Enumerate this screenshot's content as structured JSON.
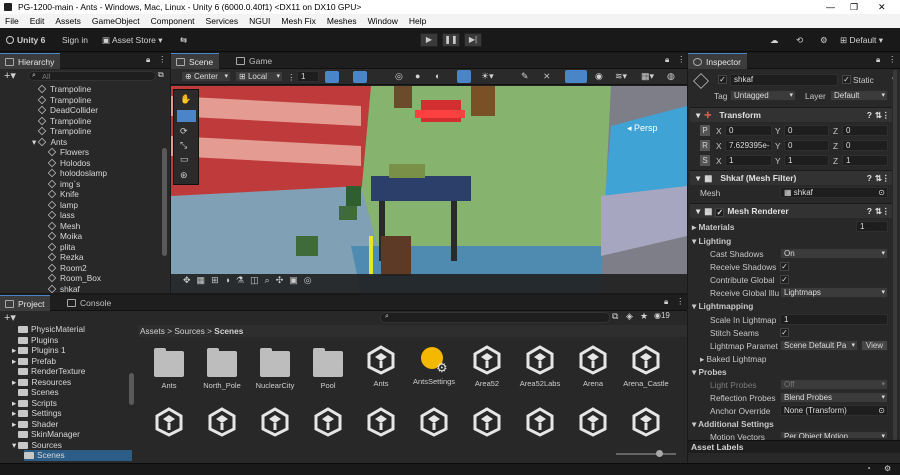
{
  "window": {
    "title": "PG-1200-main - Ants - Windows, Mac, Linux - Unity 6 (6000.0.40f1) <DX11 on DX10 GPU>"
  },
  "menu": [
    "File",
    "Edit",
    "Assets",
    "GameObject",
    "Component",
    "Services",
    "NGUI",
    "Mesh Fix",
    "Meshes",
    "Window",
    "Help"
  ],
  "toolbar": {
    "unity_label": "Unity 6",
    "signin": "Sign in",
    "asset_store": "Asset Store",
    "layout": "Default"
  },
  "hierarchy": {
    "tab": "Hierarchy",
    "search_placeholder": "All",
    "items": [
      {
        "label": "Trampoline",
        "indent": 1
      },
      {
        "label": "Trampoline",
        "indent": 1
      },
      {
        "label": "DeadCollider",
        "indent": 1
      },
      {
        "label": "Trampoline",
        "indent": 1
      },
      {
        "label": "Trampoline",
        "indent": 1
      },
      {
        "label": "Ants",
        "indent": 0,
        "expanded": true
      },
      {
        "label": "Flowers",
        "indent": 2
      },
      {
        "label": "Holodos",
        "indent": 2
      },
      {
        "label": "holodoslamp",
        "indent": 2
      },
      {
        "label": "img`s",
        "indent": 2
      },
      {
        "label": "Knife",
        "indent": 2
      },
      {
        "label": "lamp",
        "indent": 2
      },
      {
        "label": "lass",
        "indent": 2
      },
      {
        "label": "Mesh",
        "indent": 2
      },
      {
        "label": "Moika",
        "indent": 2
      },
      {
        "label": "plita",
        "indent": 2
      },
      {
        "label": "Rezka",
        "indent": 2
      },
      {
        "label": "Room2",
        "indent": 2
      },
      {
        "label": "Room_Box",
        "indent": 2
      },
      {
        "label": "shkaf",
        "indent": 2
      }
    ]
  },
  "scene": {
    "tabs": [
      "Scene",
      "Game"
    ],
    "pivot": "Center",
    "space": "Local",
    "snap": "1",
    "persp_label": "Persp"
  },
  "project": {
    "tabs": [
      "Project",
      "Console"
    ],
    "tree": [
      {
        "label": "PhysicMaterial",
        "indent": 1
      },
      {
        "label": "Plugins",
        "indent": 1
      },
      {
        "label": "Plugins 1",
        "indent": 0
      },
      {
        "label": "Prefab",
        "indent": 0
      },
      {
        "label": "RenderTexture",
        "indent": 1
      },
      {
        "label": "Resources",
        "indent": 0
      },
      {
        "label": "Scenes",
        "indent": 1
      },
      {
        "label": "Scripts",
        "indent": 0
      },
      {
        "label": "Settings",
        "indent": 0
      },
      {
        "label": "Shader",
        "indent": 0
      },
      {
        "label": "SkinManager",
        "indent": 1
      },
      {
        "label": "Sources",
        "indent": 0,
        "expanded": true
      },
      {
        "label": "Scenes",
        "indent": 2,
        "selected": true
      }
    ],
    "breadcrumb": [
      "Assets",
      "Sources",
      "Scenes"
    ],
    "count": "19",
    "assets_row1": [
      {
        "label": "Ants",
        "kind": "folder"
      },
      {
        "label": "North_Pole",
        "kind": "folder"
      },
      {
        "label": "NuclearCity",
        "kind": "folder"
      },
      {
        "label": "Pool",
        "kind": "folder"
      },
      {
        "label": "Ants",
        "kind": "unity"
      },
      {
        "label": "AntsSettings",
        "kind": "settings"
      },
      {
        "label": "Area52",
        "kind": "unity"
      },
      {
        "label": "Area52Labs",
        "kind": "unity"
      },
      {
        "label": "Arena",
        "kind": "unity"
      },
      {
        "label": "Arena_Castle",
        "kind": "unity"
      }
    ],
    "assets_row2_count": 10
  },
  "inspector": {
    "tab": "Inspector",
    "object_name": "shkaf",
    "static_label": "Static",
    "tag_label": "Tag",
    "tag": "Untagged",
    "layer_label": "Layer",
    "layer": "Default",
    "transform": {
      "title": "Transform",
      "position": {
        "label": "P",
        "x": "0",
        "y": "0",
        "z": "0"
      },
      "rotation": {
        "label": "R",
        "x": "7.629395e-",
        "y": "0",
        "z": "0"
      },
      "scale": {
        "label": "S",
        "x": "1",
        "y": "1",
        "z": "1"
      }
    },
    "mesh_filter": {
      "title": "Shkaf (Mesh Filter)",
      "mesh_label": "Mesh",
      "mesh": "shkaf"
    },
    "mesh_renderer": {
      "title": "Mesh Renderer",
      "materials_label": "Materials",
      "materials_count": "1",
      "lighting_label": "Lighting",
      "cast_shadows_label": "Cast Shadows",
      "cast_shadows": "On",
      "receive_shadows_label": "Receive Shadows",
      "contribute_gi_label": "Contribute Global",
      "receive_gi_label": "Receive Global Illu",
      "receive_gi": "Lightmaps",
      "lightmapping_label": "Lightmapping",
      "scale_lightmap_label": "Scale In Lightmap",
      "scale_lightmap": "1",
      "stitch_seams_label": "Stitch Seams",
      "lightmap_params_label": "Lightmap Paramet",
      "lightmap_params": "Scene Default Pa",
      "view_label": "View",
      "baked_label": "Baked Lightmap",
      "probes_label": "Probes",
      "light_probes_label": "Light Probes",
      "light_probes": "Off",
      "reflection_probes_label": "Reflection Probes",
      "reflection_probes": "Blend Probes",
      "anchor_label": "Anchor Override",
      "anchor": "None (Transform)",
      "additional_label": "Additional Settings",
      "motion_label": "Motion Vectors",
      "motion": "Per Object Motion"
    },
    "asset_labels": "Asset Labels"
  },
  "colors": {
    "accent": "#4a86c7",
    "bg": "#282828",
    "dark": "#191919"
  }
}
